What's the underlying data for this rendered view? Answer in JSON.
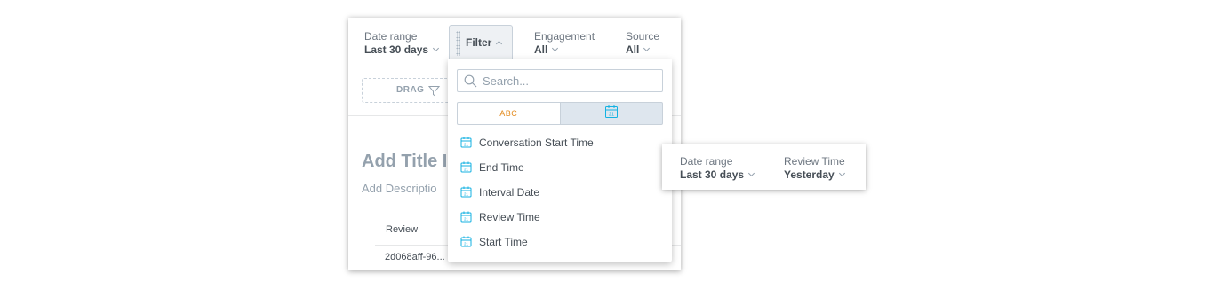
{
  "filter_bar": {
    "date_range": {
      "label": "Date range",
      "value": "Last 30 days"
    },
    "filter": {
      "label": "Filter"
    },
    "engagement": {
      "label": "Engagement",
      "value": "All"
    },
    "source": {
      "label": "Source",
      "value": "All"
    }
  },
  "drag_zone": {
    "text": "DRAG"
  },
  "dashboard": {
    "title": "Add Title I",
    "description": "Add Descriptio",
    "table": {
      "column_header": "Review",
      "first_cell": "2d068aff-96..."
    }
  },
  "dropdown": {
    "search_placeholder": "Search...",
    "toggle": {
      "text_option": "ABC",
      "date_option_icon": "calendar-icon",
      "active": "date"
    },
    "items": [
      {
        "label": "Conversation Start Time",
        "icon": "calendar-icon"
      },
      {
        "label": "End Time",
        "icon": "calendar-icon"
      },
      {
        "label": "Interval Date",
        "icon": "calendar-icon"
      },
      {
        "label": "Review Time",
        "icon": "calendar-icon"
      },
      {
        "label": "Start Time",
        "icon": "calendar-icon"
      }
    ]
  },
  "result_card": {
    "date_range": {
      "label": "Date range",
      "value": "Last 30 days"
    },
    "review_time": {
      "label": "Review Time",
      "value": "Yesterday"
    }
  },
  "colors": {
    "accent": "#14b2e2",
    "text": "#464e56",
    "muted": "#94a1ad",
    "border": "#c8d1da",
    "abc": "#e38a1c"
  }
}
